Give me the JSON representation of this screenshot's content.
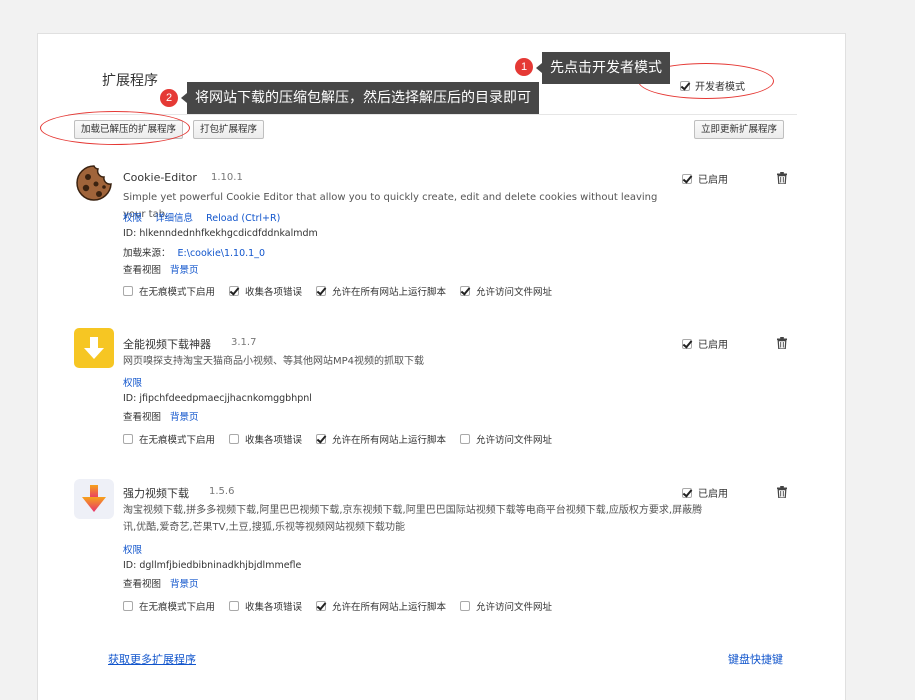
{
  "page": {
    "title": "扩展程序",
    "developer_mode_label": "开发者模式",
    "developer_mode_checked": true
  },
  "toolbar": {
    "load_unpacked": "加载已解压的扩展程序",
    "pack_extension": "打包扩展程序",
    "update_now": "立即更新扩展程序"
  },
  "extensions": [
    {
      "name": "Cookie-Editor",
      "version": "1.10.1",
      "icon": "cookie-icon",
      "description": "Simple yet powerful Cookie Editor that allow you to quickly create, edit and delete cookies without leaving your tab.",
      "links": [
        "权限",
        "详细信息",
        "Reload (Ctrl+R)"
      ],
      "id_text": "ID: hlkenndednhfkekhgcdicdfddnkalmdm",
      "source_label": "加载来源：",
      "source_path": "E:\\cookie\\1.10.1_0",
      "views_label": "查看视图",
      "views_link": "背景页",
      "enabled_label": "已启用",
      "enabled": true,
      "options": [
        {
          "label": "在无痕模式下启用",
          "checked": false
        },
        {
          "label": "收集各项错误",
          "checked": true
        },
        {
          "label": "允许在所有网站上运行脚本",
          "checked": true
        },
        {
          "label": "允许访问文件网址",
          "checked": true
        }
      ]
    },
    {
      "name": "全能视频下载神器",
      "version": "3.1.7",
      "icon": "download-arrow-icon",
      "description": "网页嗅探支持淘宝天猫商品小视频、等其他网站MP4视频的抓取下载",
      "links": [
        "权限"
      ],
      "id_text": "ID: jfipchfdeedpmaecjjhacnkomggbhpnl",
      "views_label": "查看视图",
      "views_link": "背景页",
      "enabled_label": "已启用",
      "enabled": true,
      "options": [
        {
          "label": "在无痕模式下启用",
          "checked": false
        },
        {
          "label": "收集各项错误",
          "checked": false
        },
        {
          "label": "允许在所有网站上运行脚本",
          "checked": true
        },
        {
          "label": "允许访问文件网址",
          "checked": false
        }
      ]
    },
    {
      "name": "强力视频下载",
      "version": "1.5.6",
      "icon": "gradient-download-icon",
      "description": "淘宝视频下载,拼多多视频下载,阿里巴巴视频下载,京东视频下载,阿里巴巴国际站视频下载等电商平台视频下载,应版权方要求,屏蔽腾讯,优酷,爱奇艺,芒果TV,土豆,搜狐,乐视等视频网站视频下载功能",
      "links": [
        "权限"
      ],
      "id_text": "ID: dgllmfjbiedbibninadkhjbjdlmmefle",
      "views_label": "查看视图",
      "views_link": "背景页",
      "enabled_label": "已启用",
      "enabled": true,
      "options": [
        {
          "label": "在无痕模式下启用",
          "checked": false
        },
        {
          "label": "收集各项错误",
          "checked": false
        },
        {
          "label": "允许在所有网站上运行脚本",
          "checked": true
        },
        {
          "label": "允许访问文件网址",
          "checked": false
        }
      ]
    }
  ],
  "footer": {
    "get_more": "获取更多扩展程序",
    "shortcuts": "键盘快捷键"
  },
  "annotations": {
    "step1_number": "1",
    "step1_text": "先点击开发者模式",
    "step2_number": "2",
    "step2_text": "将网站下载的压缩包解压，然后选择解压后的目录即可",
    "accent_color": "#e53935"
  }
}
